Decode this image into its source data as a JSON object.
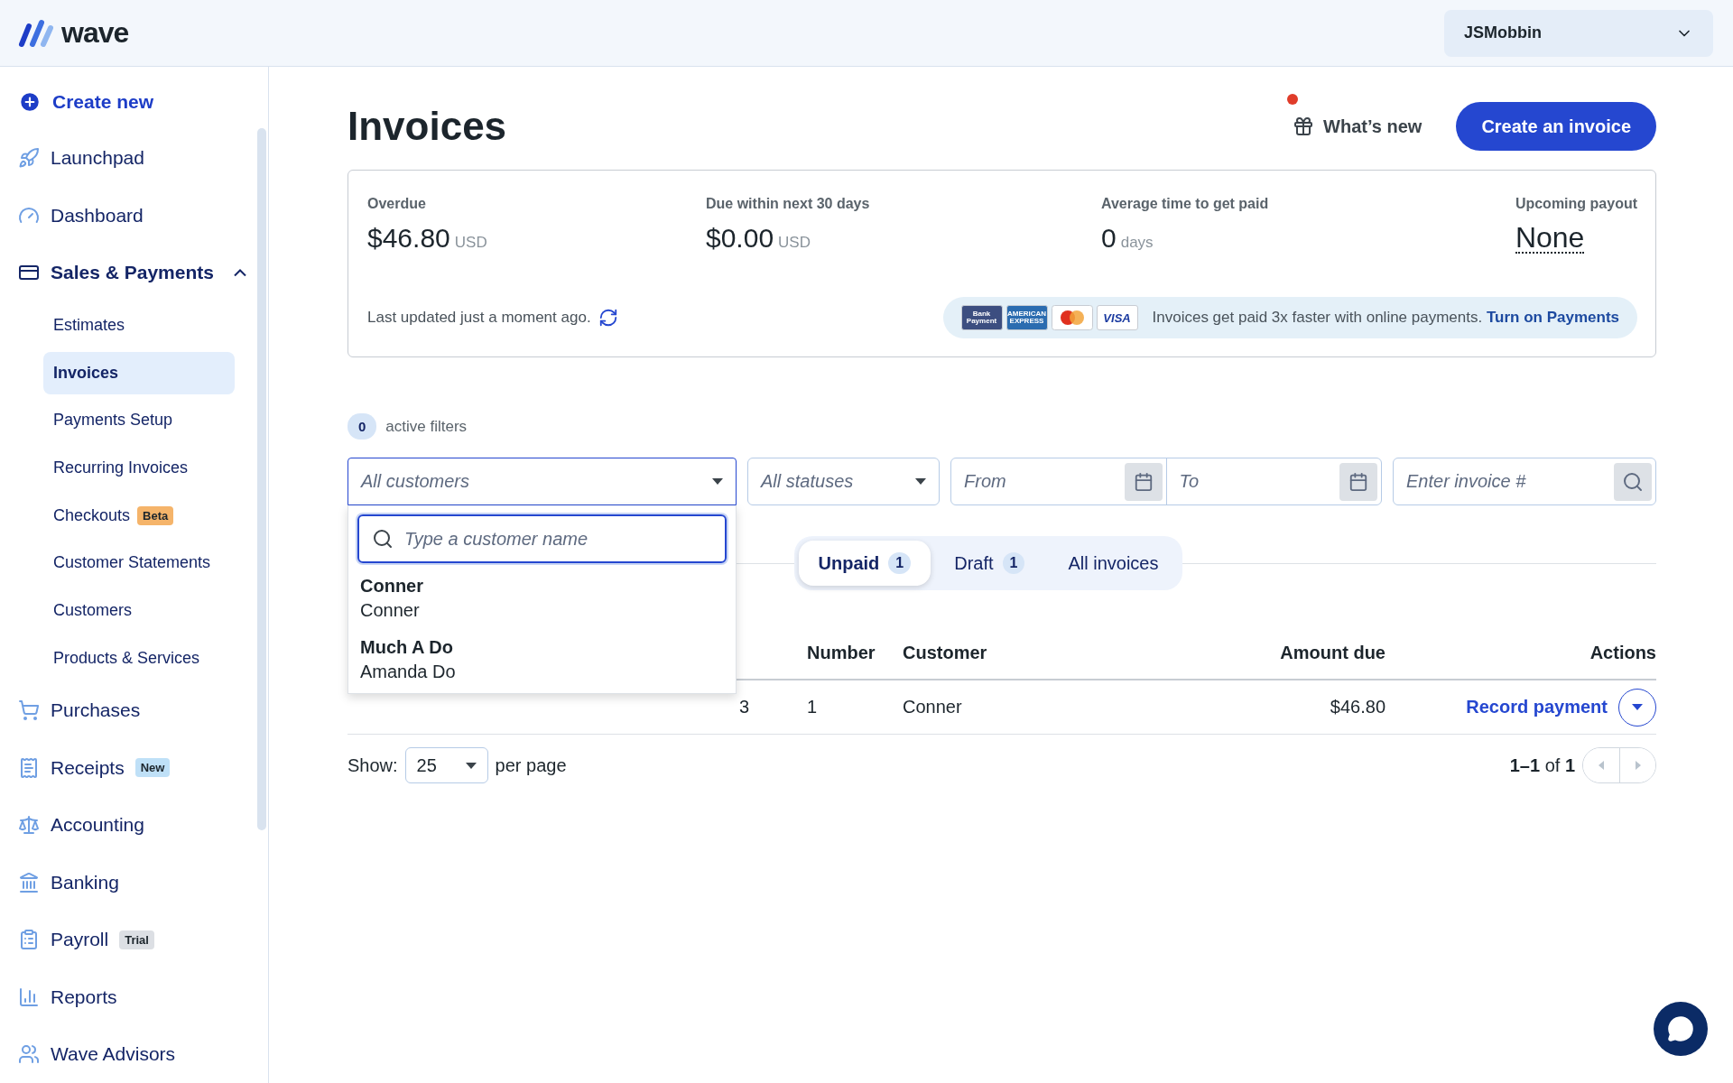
{
  "brand": {
    "name": "wave"
  },
  "account": {
    "name": "JSMobbin"
  },
  "sidebar": {
    "create_label": "Create new",
    "items": [
      {
        "label": "Launchpad"
      },
      {
        "label": "Dashboard"
      },
      {
        "label": "Sales & Payments",
        "expanded": true,
        "children": [
          {
            "label": "Estimates",
            "selected": false
          },
          {
            "label": "Invoices",
            "selected": true
          },
          {
            "label": "Payments Setup",
            "selected": false
          },
          {
            "label": "Recurring Invoices",
            "selected": false
          },
          {
            "label": "Checkouts",
            "selected": false,
            "badge": {
              "text": "Beta",
              "color": "#f5b46a"
            }
          },
          {
            "label": "Customer Statements",
            "selected": false
          },
          {
            "label": "Customers",
            "selected": false
          },
          {
            "label": "Products & Services",
            "selected": false
          }
        ]
      },
      {
        "label": "Purchases"
      },
      {
        "label": "Receipts",
        "badge": {
          "text": "New",
          "color": "#bfe0f7"
        }
      },
      {
        "label": "Accounting"
      },
      {
        "label": "Banking"
      },
      {
        "label": "Payroll",
        "badge": {
          "text": "Trial",
          "color": "#dcdfe4"
        }
      },
      {
        "label": "Reports"
      },
      {
        "label": "Wave Advisors"
      }
    ]
  },
  "header": {
    "title": "Invoices",
    "whats_new": "What’s new",
    "has_notification": true,
    "primary_button": "Create an invoice"
  },
  "summary": {
    "stats": [
      {
        "kind": "amount",
        "label": "Overdue",
        "value": "$46.80",
        "unit": "USD"
      },
      {
        "kind": "amount",
        "label": "Due within next 30 days",
        "value": "$0.00",
        "unit": "USD"
      },
      {
        "kind": "amount",
        "label": "Average time to get paid",
        "value": "0",
        "unit": "days"
      },
      {
        "kind": "payout",
        "label": "Upcoming payout",
        "value": "None"
      }
    ],
    "last_updated": "Last updated just a moment ago.",
    "payment_methods": [
      "Bank Payment",
      "AMERICAN EXPRESS",
      "VISA"
    ],
    "promo_text": "Invoices get paid 3x faster with online payments.",
    "promo_link": "Turn on Payments"
  },
  "filters": {
    "active_count": "0",
    "active_label": "active filters",
    "customer": {
      "placeholder": "All customers",
      "open": true
    },
    "status": {
      "placeholder": "All statuses"
    },
    "from": {
      "placeholder": "From"
    },
    "to": {
      "placeholder": "To"
    },
    "invoice": {
      "placeholder": "Enter invoice #"
    }
  },
  "customer_dropdown": {
    "search_placeholder": "Type a customer name",
    "options": [
      {
        "name": "Conner",
        "contact": "Conner"
      },
      {
        "name": "Much A Do",
        "contact": "Amanda Do"
      }
    ]
  },
  "tabs": [
    {
      "label": "Unpaid",
      "count": "1",
      "selected": true
    },
    {
      "label": "Draft",
      "count": "1",
      "selected": false
    },
    {
      "label": "All invoices",
      "selected": false
    }
  ],
  "table": {
    "columns": [
      "Number",
      "Customer",
      "Amount due",
      "Actions"
    ],
    "rows": [
      {
        "column_1": "3",
        "number": "1",
        "customer": "Conner",
        "amount": "$46.80",
        "action": "Record payment"
      }
    ]
  },
  "pagination": {
    "show_label": "Show:",
    "per_page": "25",
    "per_page_label": "per page",
    "range": "**1–1** of **1**"
  }
}
